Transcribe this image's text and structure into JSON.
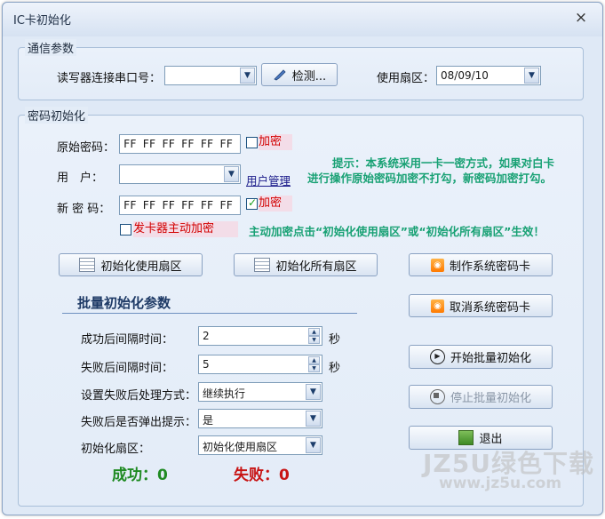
{
  "window": {
    "title": "IC卡初始化",
    "close_glyph": "×"
  },
  "comm": {
    "legend": "通信参数",
    "port_label": "读写器连接串口号：",
    "port_value": "",
    "detect_button": "检测...",
    "sector_label": "使用扇区：",
    "sector_value": "08/09/10"
  },
  "pwd": {
    "legend": "密码初始化",
    "orig_label": "原始密码：",
    "orig_value": "FF FF FF FF FF FF",
    "orig_encrypt": "加密",
    "orig_encrypt_checked": false,
    "user_label": "用　户：",
    "user_value": "",
    "user_manage": "用户管理",
    "new_label": "新 密 码：",
    "new_value": "FF FF FF FF FF FF",
    "new_encrypt": "加密",
    "new_encrypt_checked": true,
    "issuer_encrypt": "发卡器主动加密",
    "issuer_encrypt_checked": false,
    "hint1": "提示：本系统采用一卡一密方式，如果对白卡",
    "hint2": "进行操作原始密码加密不打勾，新密码加密打勾。",
    "hint3": "主动加密点击“初始化使用扇区”或“初始化所有扇区”生效！"
  },
  "buttons": {
    "init_used": "初始化使用扇区",
    "init_all": "初始化所有扇区",
    "make_sys_card": "制作系统密码卡",
    "cancel_sys_card": "取消系统密码卡",
    "start_batch": "开始批量初始化",
    "stop_batch": "停止批量初始化",
    "exit": "退出"
  },
  "batch": {
    "title": "批量初始化参数",
    "success_interval_label": "成功后间隔时间：",
    "success_interval_value": "2",
    "fail_interval_label": "失败后间隔时间：",
    "fail_interval_value": "5",
    "seconds_unit": "秒",
    "fail_action_label": "设置失败后处理方式：",
    "fail_action_value": "继续执行",
    "popup_label": "失败后是否弹出提示：",
    "popup_value": "是",
    "sector_label": "初始化扇区：",
    "sector_value": "初始化使用扇区"
  },
  "status": {
    "success": "成功：0",
    "fail": "失败：0"
  },
  "watermark": {
    "brand": "JZ5U绿色下载",
    "url": "www.jz5u.com"
  }
}
